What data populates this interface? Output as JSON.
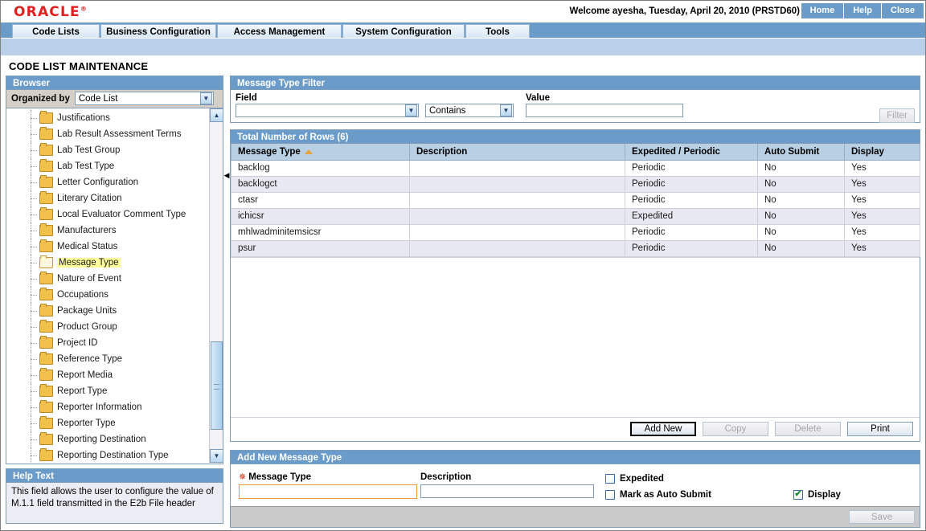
{
  "header": {
    "logo": "ORACLE",
    "logo_tm": "®",
    "welcome": "Welcome ayesha, Tuesday, April 20, 2010 (PRSTD60)",
    "links": [
      "Home",
      "Help",
      "Close"
    ]
  },
  "tabs": [
    {
      "label": "Code Lists"
    },
    {
      "label": "Business Configuration"
    },
    {
      "label": "Access Management"
    },
    {
      "label": "System Configuration"
    },
    {
      "label": "Tools"
    }
  ],
  "page_title": "CODE LIST MAINTENANCE",
  "browser": {
    "title": "Browser",
    "organized_by_label": "Organized by",
    "organized_by_value": "Code List",
    "tree_items": [
      {
        "label": "Justifications",
        "selected": false
      },
      {
        "label": "Lab Result Assessment Terms",
        "selected": false
      },
      {
        "label": "Lab Test Group",
        "selected": false
      },
      {
        "label": "Lab Test Type",
        "selected": false
      },
      {
        "label": "Letter Configuration",
        "selected": false
      },
      {
        "label": "Literary Citation",
        "selected": false
      },
      {
        "label": "Local Evaluator Comment Type",
        "selected": false
      },
      {
        "label": "Manufacturers",
        "selected": false
      },
      {
        "label": "Medical Status",
        "selected": false
      },
      {
        "label": "Message Type",
        "selected": true
      },
      {
        "label": "Nature of Event",
        "selected": false
      },
      {
        "label": "Occupations",
        "selected": false
      },
      {
        "label": "Package Units",
        "selected": false
      },
      {
        "label": "Product Group",
        "selected": false
      },
      {
        "label": "Project ID",
        "selected": false
      },
      {
        "label": "Reference Type",
        "selected": false
      },
      {
        "label": "Report Media",
        "selected": false
      },
      {
        "label": "Report Type",
        "selected": false
      },
      {
        "label": "Reporter Information",
        "selected": false
      },
      {
        "label": "Reporter Type",
        "selected": false
      },
      {
        "label": "Reporting Destination",
        "selected": false
      },
      {
        "label": "Reporting Destination Type",
        "selected": false
      }
    ]
  },
  "help": {
    "title": "Help Text",
    "text": "This field allows the user to configure the value of M.1.1 field transmitted in the E2b File header"
  },
  "filter": {
    "title": "Message Type Filter",
    "field_label": "Field",
    "field_value": "",
    "operator_value": "Contains",
    "value_label": "Value",
    "value_value": "",
    "button_label": "Filter",
    "button_disabled": true
  },
  "grid": {
    "title": "Total Number of Rows (6)",
    "columns": [
      "Message Type",
      "Description",
      "Expedited / Periodic",
      "Auto Submit",
      "Display"
    ],
    "sort_column": "Message Type",
    "sort_direction": "ascending",
    "rows": [
      {
        "message_type": "backlog",
        "description": "",
        "expedited_periodic": "Periodic",
        "auto_submit": "No",
        "display": "Yes"
      },
      {
        "message_type": "backlogct",
        "description": "",
        "expedited_periodic": "Periodic",
        "auto_submit": "No",
        "display": "Yes"
      },
      {
        "message_type": "ctasr",
        "description": "",
        "expedited_periodic": "Periodic",
        "auto_submit": "No",
        "display": "Yes"
      },
      {
        "message_type": "ichicsr",
        "description": "",
        "expedited_periodic": "Expedited",
        "auto_submit": "No",
        "display": "Yes"
      },
      {
        "message_type": "mhlwadminitemsicsr",
        "description": "",
        "expedited_periodic": "Periodic",
        "auto_submit": "No",
        "display": "Yes"
      },
      {
        "message_type": "psur",
        "description": "",
        "expedited_periodic": "Periodic",
        "auto_submit": "No",
        "display": "Yes"
      }
    ],
    "buttons": [
      {
        "label": "Add New",
        "disabled": false,
        "focused": true
      },
      {
        "label": "Copy",
        "disabled": true,
        "focused": false
      },
      {
        "label": "Delete",
        "disabled": true,
        "focused": false
      },
      {
        "label": "Print",
        "disabled": false,
        "focused": false
      }
    ]
  },
  "add_form": {
    "title": "Add New Message Type",
    "message_type_label": "Message Type",
    "message_type_value": "",
    "message_type_required": true,
    "description_label": "Description",
    "description_value": "",
    "expedited_label": "Expedited",
    "expedited_checked": false,
    "auto_submit_label": "Mark as Auto Submit",
    "auto_submit_checked": false,
    "display_label": "Display",
    "display_checked": true,
    "save_label": "Save",
    "save_disabled": true
  },
  "colors": {
    "oracle_red": "#e02020",
    "panel_header_blue": "#6a9bc9",
    "tab_strip_blue": "#b9d0e8",
    "grid_header_blue": "#b8cfe4",
    "row_alt": "#e8e8f2",
    "highlight_yellow": "#ffff99",
    "required_marker": "#cc2200",
    "focus_orange": "#e89a32"
  }
}
